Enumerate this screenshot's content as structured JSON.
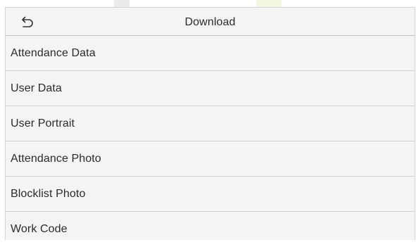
{
  "header": {
    "title": "Download",
    "back_icon": "back-arrow-icon"
  },
  "menu": {
    "items": [
      {
        "label": "Attendance Data"
      },
      {
        "label": "User Data"
      },
      {
        "label": "User Portrait"
      },
      {
        "label": "Attendance Photo"
      },
      {
        "label": "Blocklist Photo"
      },
      {
        "label": "Work Code"
      }
    ]
  },
  "colors": {
    "background": "#f4f4f4",
    "text": "#2b2b2b",
    "divider": "#d2d2d2"
  }
}
